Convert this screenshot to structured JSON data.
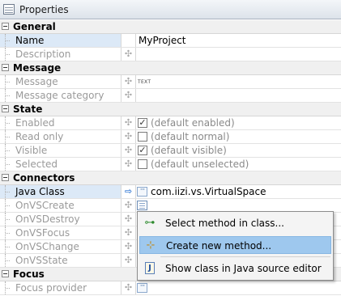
{
  "panel": {
    "title": "Properties"
  },
  "categories": {
    "general": "General",
    "message": "Message",
    "state": "State",
    "connectors": "Connectors",
    "focus": "Focus"
  },
  "props": {
    "name": {
      "label": "Name",
      "value": "MyProject"
    },
    "description": {
      "label": "Description"
    },
    "message": {
      "label": "Message",
      "value": "TEXT"
    },
    "message_category": {
      "label": "Message category"
    },
    "enabled": {
      "label": "Enabled",
      "value": "(default enabled)",
      "checked": true
    },
    "read_only": {
      "label": "Read only",
      "value": "(default normal)",
      "checked": false
    },
    "visible": {
      "label": "Visible",
      "value": "(default visible)",
      "checked": true
    },
    "selected": {
      "label": "Selected",
      "value": "(default unselected)",
      "checked": false
    },
    "java_class": {
      "label": "Java Class",
      "value": "com.iizi.vs.VirtualSpace"
    },
    "on_vs_create": {
      "label": "OnVSCreate"
    },
    "on_vs_destroy": {
      "label": "OnVSDestroy"
    },
    "on_vs_focus": {
      "label": "OnVSFocus"
    },
    "on_vs_change": {
      "label": "OnVSChange"
    },
    "on_vs_state": {
      "label": "OnVSState"
    },
    "focus_provider": {
      "label": "Focus provider"
    }
  },
  "context_menu": {
    "items": [
      {
        "label": "Select method in class...",
        "icon": "method-arrow-icon"
      },
      {
        "label": "Create new method...",
        "icon": "new-method-icon",
        "selected": true
      },
      {
        "label": "Show class in Java source editor",
        "icon": "java-source-icon"
      }
    ]
  },
  "colors": {
    "selection": "#9ec8ee",
    "category_bg": "#f0f0f0",
    "dim_text": "#9a9a9a",
    "link_arrow": "#3d7fd6"
  }
}
